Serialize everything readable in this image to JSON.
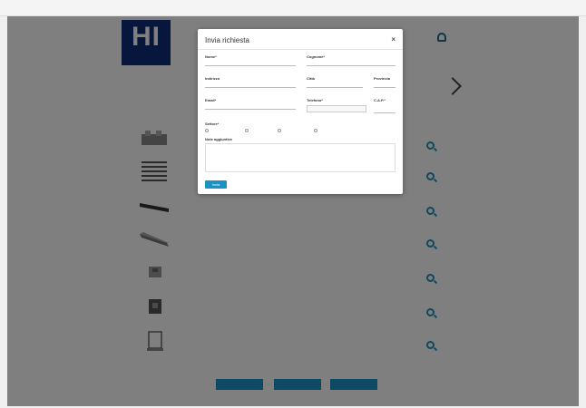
{
  "browser": {
    "left_text": "",
    "url": "",
    "right_text": ""
  },
  "header": {
    "logo_big": "HI",
    "logo_small": "",
    "col1_label": "",
    "col2_label": "",
    "account_label": ""
  },
  "sidebar": {
    "title": "",
    "items": [],
    "filter_left": "",
    "filter_right": "",
    "section_title": ""
  },
  "table": {
    "col_action": ""
  },
  "products": [
    {
      "code": "",
      "name": ""
    },
    {
      "code": "",
      "name": ""
    },
    {
      "code": "",
      "name": ""
    },
    {
      "code": "",
      "name": ""
    },
    {
      "code": "",
      "name": ""
    },
    {
      "code": "",
      "name": ""
    },
    {
      "code": "",
      "name": ""
    },
    {
      "code": "",
      "name": ""
    }
  ],
  "pager": {
    "prev": "",
    "mid": "",
    "next": "",
    "footer": ""
  },
  "modal": {
    "title": "Invia richiesta",
    "close": "×",
    "fields": {
      "nome": "Nome*",
      "cognome": "Cognome*",
      "indirizzo": "Indirizzo",
      "citta": "Città",
      "provincia": "Provincia",
      "email": "Email*",
      "telefono": "Telefono*",
      "cap": "C.A.P.*",
      "select_value": ""
    },
    "settore_label": "Settore*",
    "settore_options": [
      "",
      "",
      "",
      ""
    ],
    "note_label": "Note aggiuntive",
    "note_placeholder": "",
    "send_label": "Invia"
  }
}
